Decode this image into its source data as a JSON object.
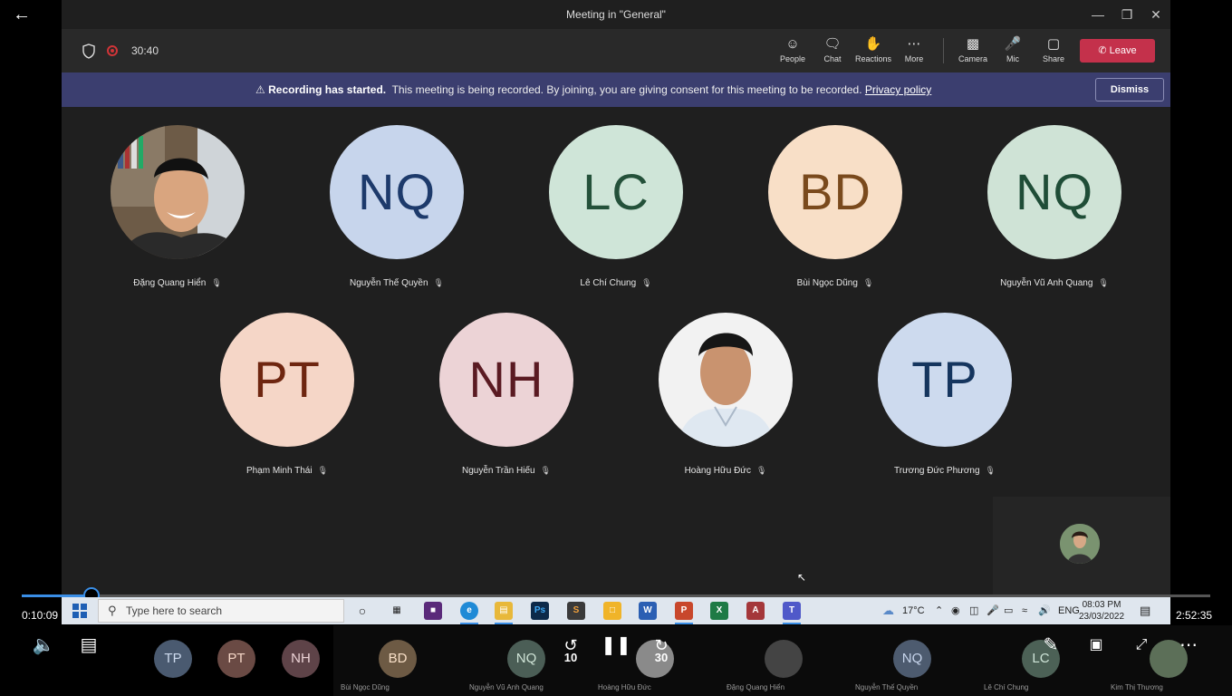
{
  "window": {
    "title": "Meeting in \"General\""
  },
  "toolbar": {
    "timer": "30:40",
    "buttons": [
      {
        "label": "People",
        "icon": "people-icon"
      },
      {
        "label": "Chat",
        "icon": "chat-icon"
      },
      {
        "label": "Reactions",
        "icon": "reactions-icon"
      },
      {
        "label": "More",
        "icon": "more-icon"
      },
      {
        "label": "Camera",
        "icon": "camera-off-icon"
      },
      {
        "label": "Mic",
        "icon": "mic-icon"
      },
      {
        "label": "Share",
        "icon": "share-icon"
      }
    ],
    "leave_label": "Leave"
  },
  "banner": {
    "title": "Recording has started.",
    "message": "This meeting is being recorded. By joining, you are giving consent for this meeting to be recorded.",
    "link": "Privacy policy",
    "dismiss_label": "Dismiss"
  },
  "participants": [
    {
      "name": "Đặng Quang Hiển",
      "initials": "",
      "photo": true
    },
    {
      "name": "Nguyễn Thế Quyền",
      "initials": "NQ",
      "bg": "#c7d5ec",
      "fg": "#1d3a6b"
    },
    {
      "name": "Lê Chí Chung",
      "initials": "LC",
      "bg": "#cfe5d8",
      "fg": "#24513a"
    },
    {
      "name": "Bùi Ngọc Dũng",
      "initials": "BD",
      "bg": "#f8dfc7",
      "fg": "#7a4a1d"
    },
    {
      "name": "Nguyễn Vũ Anh Quang",
      "initials": "NQ",
      "bg": "#cfe3d6",
      "fg": "#1f4d37"
    },
    {
      "name": "Phạm Minh Thái",
      "initials": "PT",
      "bg": "#f5d6c7",
      "fg": "#6e2610"
    },
    {
      "name": "Nguyễn Trần Hiếu",
      "initials": "NH",
      "bg": "#ecd3d6",
      "fg": "#5a1a22"
    },
    {
      "name": "Hoàng Hữu Đức",
      "initials": "",
      "photo": true
    },
    {
      "name": "Trương Đức Phương",
      "initials": "TP",
      "bg": "#cddaee",
      "fg": "#15355e"
    }
  ],
  "player": {
    "current_time": "0:10:09",
    "total_time": "2:52:35",
    "progress": 0.059,
    "skip_back": "10",
    "skip_forward": "30"
  },
  "taskbar": {
    "search_placeholder": "Type here to search",
    "weather": "17°C",
    "lang": "ENG",
    "time": "08:03 PM",
    "date": "23/03/2022"
  },
  "gallery": [
    {
      "initials": "TP",
      "name": "",
      "bg": "#4a5a70"
    },
    {
      "initials": "PT",
      "name": "",
      "bg": "#6a4a44"
    },
    {
      "initials": "NH",
      "name": "",
      "bg": "#5e4348"
    },
    {
      "initials": "BD",
      "name": "Bùi Ngọc Dũng",
      "bg": "#6d5a44"
    },
    {
      "initials": "NQ",
      "name": "Nguyễn Vũ Anh Quang",
      "bg": "#4b5e56"
    },
    {
      "initials": "",
      "name": "Hoàng Hữu Đức",
      "bg": "#777"
    },
    {
      "initials": "",
      "name": "Đặng Quang Hiển",
      "bg": "#444"
    },
    {
      "initials": "NQ",
      "name": "Nguyễn Thế Quyền",
      "bg": "#4d5b6f"
    },
    {
      "initials": "LC",
      "name": "Lê Chí Chung",
      "bg": "#4c6156"
    },
    {
      "initials": "",
      "name": "Kim Thị Thương",
      "bg": "#5c6f58"
    }
  ]
}
